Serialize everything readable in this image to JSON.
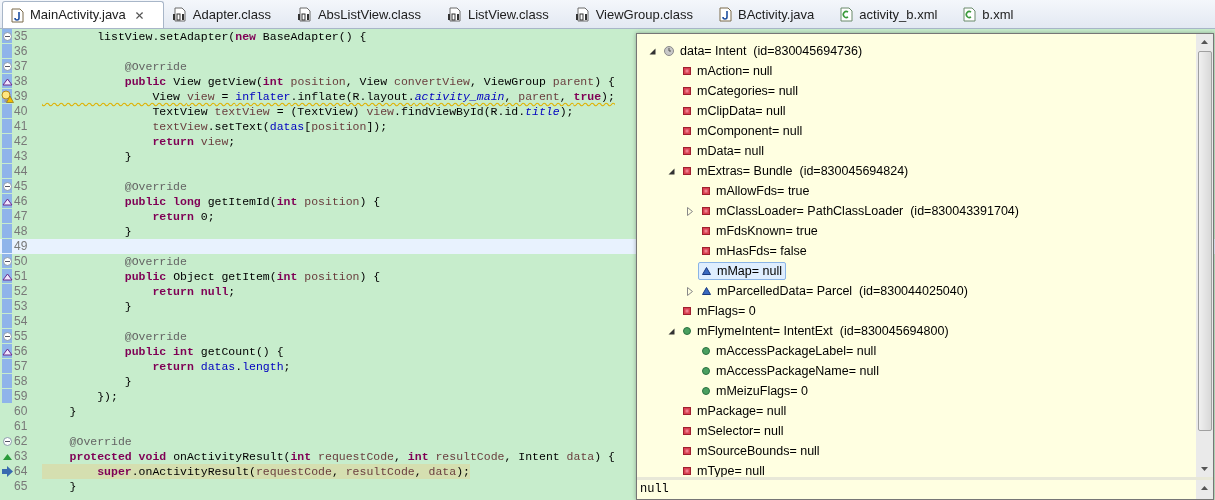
{
  "tabs": [
    {
      "label": "MainActivity.java",
      "kind": "java",
      "selected": true,
      "closable": true
    },
    {
      "label": "Adapter.class",
      "kind": "class",
      "selected": false,
      "closable": false
    },
    {
      "label": "AbsListView.class",
      "kind": "class",
      "selected": false,
      "closable": false
    },
    {
      "label": "ListView.class",
      "kind": "class",
      "selected": false,
      "closable": false
    },
    {
      "label": "ViewGroup.class",
      "kind": "class",
      "selected": false,
      "closable": false
    },
    {
      "label": "BActivity.java",
      "kind": "java",
      "selected": false,
      "closable": false
    },
    {
      "label": "activity_b.xml",
      "kind": "xml",
      "selected": false,
      "closable": false
    },
    {
      "label": "b.xml",
      "kind": "xml",
      "selected": false,
      "closable": false
    }
  ],
  "editor": {
    "lines": [
      {
        "number": "35",
        "fold": true,
        "override": false,
        "implements": false,
        "warning": false,
        "debug": false,
        "current": false,
        "changed": true,
        "code": [
          {
            "kind": "plain",
            "text": "        listView.setAdapter("
          },
          {
            "kind": "keyword",
            "text": "new"
          },
          {
            "kind": "plain",
            "text": " BaseAdapter() {"
          }
        ]
      },
      {
        "number": "36",
        "fold": false,
        "override": false,
        "implements": false,
        "warning": false,
        "debug": false,
        "current": false,
        "changed": true
      },
      {
        "number": "37",
        "fold": true,
        "override": false,
        "implements": false,
        "warning": false,
        "debug": false,
        "current": false,
        "changed": true,
        "code": [
          {
            "kind": "annotation",
            "text": "            @Override"
          }
        ]
      },
      {
        "number": "38",
        "fold": false,
        "override": true,
        "implements": false,
        "warning": false,
        "debug": false,
        "current": false,
        "changed": true,
        "code": [
          {
            "kind": "keyword",
            "text": "            public"
          },
          {
            "kind": "plain",
            "text": " View getView("
          },
          {
            "kind": "keyword",
            "text": "int"
          },
          {
            "kind": "variable",
            "text": " position"
          },
          {
            "kind": "plain",
            "text": ", View "
          },
          {
            "kind": "variable",
            "text": "convertView"
          },
          {
            "kind": "plain",
            "text": ", ViewGroup "
          },
          {
            "kind": "variable",
            "text": "parent"
          },
          {
            "kind": "plain",
            "text": ") {"
          }
        ]
      },
      {
        "number": "39",
        "fold": false,
        "override": false,
        "implements": false,
        "warning": true,
        "debug": false,
        "current": false,
        "changed": true,
        "code": [
          {
            "kind": "plain",
            "text": "                View "
          },
          {
            "kind": "variable",
            "text": "view"
          },
          {
            "kind": "plain",
            "text": " = "
          },
          {
            "kind": "field",
            "text": "inflater"
          },
          {
            "kind": "plain",
            "text": ".inflate(R.layout."
          },
          {
            "kind": "static",
            "text": "activity_main"
          },
          {
            "kind": "plain",
            "text": ", "
          },
          {
            "kind": "variable",
            "text": "parent"
          },
          {
            "kind": "plain",
            "text": ", "
          },
          {
            "kind": "keyword",
            "text": "true"
          },
          {
            "kind": "plain",
            "text": ");"
          }
        ]
      },
      {
        "number": "40",
        "fold": false,
        "override": false,
        "implements": false,
        "warning": false,
        "debug": false,
        "current": false,
        "changed": true,
        "code": [
          {
            "kind": "plain",
            "text": "                TextView "
          },
          {
            "kind": "variable",
            "text": "textView"
          },
          {
            "kind": "plain",
            "text": " = (TextView) "
          },
          {
            "kind": "variable",
            "text": "view"
          },
          {
            "kind": "plain",
            "text": ".findViewById(R.id."
          },
          {
            "kind": "static",
            "text": "title"
          },
          {
            "kind": "plain",
            "text": ");"
          }
        ]
      },
      {
        "number": "41",
        "fold": false,
        "override": false,
        "implements": false,
        "warning": false,
        "debug": false,
        "current": false,
        "changed": true,
        "code": [
          {
            "kind": "variable",
            "text": "                textView"
          },
          {
            "kind": "plain",
            "text": ".setText("
          },
          {
            "kind": "field",
            "text": "datas"
          },
          {
            "kind": "plain",
            "text": "["
          },
          {
            "kind": "variable",
            "text": "position"
          },
          {
            "kind": "plain",
            "text": "]);"
          }
        ]
      },
      {
        "number": "42",
        "fold": false,
        "override": false,
        "implements": false,
        "warning": false,
        "debug": false,
        "current": false,
        "changed": true,
        "code": [
          {
            "kind": "keyword",
            "text": "                return"
          },
          {
            "kind": "variable",
            "text": " view"
          },
          {
            "kind": "plain",
            "text": ";"
          }
        ]
      },
      {
        "number": "43",
        "fold": false,
        "override": false,
        "implements": false,
        "warning": false,
        "debug": false,
        "current": false,
        "changed": true,
        "code": [
          {
            "kind": "plain",
            "text": "            }"
          }
        ]
      },
      {
        "number": "44",
        "fold": false,
        "override": false,
        "implements": false,
        "warning": false,
        "debug": false,
        "current": false,
        "changed": true
      },
      {
        "number": "45",
        "fold": true,
        "override": false,
        "implements": false,
        "warning": false,
        "debug": false,
        "current": false,
        "changed": true,
        "code": [
          {
            "kind": "annotation",
            "text": "            @Override"
          }
        ]
      },
      {
        "number": "46",
        "fold": false,
        "override": true,
        "implements": false,
        "warning": false,
        "debug": false,
        "current": false,
        "changed": true,
        "code": [
          {
            "kind": "keyword",
            "text": "            public long"
          },
          {
            "kind": "plain",
            "text": " getItemId("
          },
          {
            "kind": "keyword",
            "text": "int"
          },
          {
            "kind": "variable",
            "text": " position"
          },
          {
            "kind": "plain",
            "text": ") {"
          }
        ]
      },
      {
        "number": "47",
        "fold": false,
        "override": false,
        "implements": false,
        "warning": false,
        "debug": false,
        "current": false,
        "changed": true,
        "code": [
          {
            "kind": "keyword",
            "text": "                return"
          },
          {
            "kind": "plain",
            "text": " 0;"
          }
        ]
      },
      {
        "number": "48",
        "fold": false,
        "override": false,
        "implements": false,
        "warning": false,
        "debug": false,
        "current": false,
        "changed": true,
        "code": [
          {
            "kind": "plain",
            "text": "            }"
          }
        ]
      },
      {
        "number": "49",
        "fold": false,
        "override": false,
        "implements": false,
        "warning": false,
        "debug": false,
        "current": true,
        "changed": true
      },
      {
        "number": "50",
        "fold": true,
        "override": false,
        "implements": false,
        "warning": false,
        "debug": false,
        "current": false,
        "changed": true,
        "code": [
          {
            "kind": "annotation",
            "text": "            @Override"
          }
        ]
      },
      {
        "number": "51",
        "fold": false,
        "override": true,
        "implements": false,
        "warning": false,
        "debug": false,
        "current": false,
        "changed": true,
        "code": [
          {
            "kind": "keyword",
            "text": "            public"
          },
          {
            "kind": "plain",
            "text": " Object getItem("
          },
          {
            "kind": "keyword",
            "text": "int"
          },
          {
            "kind": "variable",
            "text": " position"
          },
          {
            "kind": "plain",
            "text": ") {"
          }
        ]
      },
      {
        "number": "52",
        "fold": false,
        "override": false,
        "implements": false,
        "warning": false,
        "debug": false,
        "current": false,
        "changed": true,
        "code": [
          {
            "kind": "keyword",
            "text": "                return null"
          },
          {
            "kind": "plain",
            "text": ";"
          }
        ]
      },
      {
        "number": "53",
        "fold": false,
        "override": false,
        "implements": false,
        "warning": false,
        "debug": false,
        "current": false,
        "changed": true,
        "code": [
          {
            "kind": "plain",
            "text": "            }"
          }
        ]
      },
      {
        "number": "54",
        "fold": false,
        "override": false,
        "implements": false,
        "warning": false,
        "debug": false,
        "current": false,
        "changed": true
      },
      {
        "number": "55",
        "fold": true,
        "override": false,
        "implements": false,
        "warning": false,
        "debug": false,
        "current": false,
        "changed": true,
        "code": [
          {
            "kind": "annotation",
            "text": "            @Override"
          }
        ]
      },
      {
        "number": "56",
        "fold": false,
        "override": true,
        "implements": false,
        "warning": false,
        "debug": false,
        "current": false,
        "changed": true,
        "code": [
          {
            "kind": "keyword",
            "text": "            public int"
          },
          {
            "kind": "plain",
            "text": " getCount() {"
          }
        ]
      },
      {
        "number": "57",
        "fold": false,
        "override": false,
        "implements": false,
        "warning": false,
        "debug": false,
        "current": false,
        "changed": true,
        "code": [
          {
            "kind": "keyword",
            "text": "                return"
          },
          {
            "kind": "field",
            "text": " datas"
          },
          {
            "kind": "plain",
            "text": "."
          },
          {
            "kind": "field",
            "text": "length"
          },
          {
            "kind": "plain",
            "text": ";"
          }
        ]
      },
      {
        "number": "58",
        "fold": false,
        "override": false,
        "implements": false,
        "warning": false,
        "debug": false,
        "current": false,
        "changed": true,
        "code": [
          {
            "kind": "plain",
            "text": "            }"
          }
        ]
      },
      {
        "number": "59",
        "fold": false,
        "override": false,
        "implements": false,
        "warning": false,
        "debug": false,
        "current": false,
        "changed": true,
        "code": [
          {
            "kind": "plain",
            "text": "        });"
          }
        ]
      },
      {
        "number": "60",
        "fold": false,
        "override": false,
        "implements": false,
        "warning": false,
        "debug": false,
        "current": false,
        "changed": false,
        "code": [
          {
            "kind": "plain",
            "text": "    }"
          }
        ]
      },
      {
        "number": "61",
        "fold": false,
        "override": false,
        "implements": false,
        "warning": false,
        "debug": false,
        "current": false,
        "changed": false
      },
      {
        "number": "62",
        "fold": true,
        "override": false,
        "implements": false,
        "warning": false,
        "debug": false,
        "current": false,
        "changed": false,
        "code": [
          {
            "kind": "annotation",
            "text": "    @Override"
          }
        ]
      },
      {
        "number": "63",
        "fold": false,
        "override": false,
        "implements": true,
        "warning": false,
        "debug": false,
        "current": false,
        "changed": false,
        "code": [
          {
            "kind": "keyword",
            "text": "    protected void"
          },
          {
            "kind": "plain",
            "text": " onActivityResult("
          },
          {
            "kind": "keyword",
            "text": "int"
          },
          {
            "kind": "variable",
            "text": " requestCode"
          },
          {
            "kind": "plain",
            "text": ", "
          },
          {
            "kind": "keyword",
            "text": "int"
          },
          {
            "kind": "variable",
            "text": " resultCode"
          },
          {
            "kind": "plain",
            "text": ", Intent "
          },
          {
            "kind": "variable",
            "text": "data"
          },
          {
            "kind": "plain",
            "text": ") {"
          }
        ]
      },
      {
        "number": "64",
        "fold": false,
        "override": false,
        "implements": false,
        "warning": false,
        "debug": true,
        "current": false,
        "changed": false,
        "code": [
          {
            "kind": "keyword",
            "text": "        super"
          },
          {
            "kind": "plain",
            "text": ".onActivityResult("
          },
          {
            "kind": "variable",
            "text": "requestCode"
          },
          {
            "kind": "plain",
            "text": ", "
          },
          {
            "kind": "variable",
            "text": "resultCode"
          },
          {
            "kind": "plain",
            "text": ", "
          },
          {
            "kind": "variable",
            "text": "data"
          },
          {
            "kind": "plain",
            "text": ");"
          }
        ]
      },
      {
        "number": "65",
        "fold": false,
        "override": false,
        "implements": false,
        "warning": false,
        "debug": false,
        "current": false,
        "changed": false,
        "code": [
          {
            "kind": "plain",
            "text": "    }"
          }
        ]
      }
    ]
  },
  "inspector": {
    "tree": [
      {
        "label": "data= Intent  (id=830045694736)",
        "kind": "local",
        "expanded": true,
        "selected": false,
        "children": [
          {
            "label": "mAction= null",
            "kind": "private",
            "selected": false
          },
          {
            "label": "mCategories= null",
            "kind": "private",
            "selected": false
          },
          {
            "label": "mClipData= null",
            "kind": "private",
            "selected": false
          },
          {
            "label": "mComponent= null",
            "kind": "private",
            "selected": false
          },
          {
            "label": "mData= null",
            "kind": "private",
            "selected": false
          },
          {
            "label": "mExtras= Bundle  (id=830045694824)",
            "kind": "private",
            "expanded": true,
            "selected": false,
            "children": [
              {
                "label": "mAllowFds= true",
                "kind": "private",
                "selected": false
              },
              {
                "label": "mClassLoader= PathClassLoader  (id=830043391704)",
                "kind": "private",
                "expanded": false,
                "selected": false
              },
              {
                "label": "mFdsKnown= true",
                "kind": "private",
                "selected": false
              },
              {
                "label": "mHasFds= false",
                "kind": "private",
                "selected": false
              },
              {
                "label": "mMap= null",
                "kind": "package",
                "selected": true
              },
              {
                "label": "mParcelledData= Parcel  (id=830044025040)",
                "kind": "package",
                "expanded": false,
                "selected": false
              }
            ]
          },
          {
            "label": "mFlags= 0",
            "kind": "private",
            "selected": false
          },
          {
            "label": "mFlymeIntent= IntentExt  (id=830045694800)",
            "kind": "public",
            "expanded": true,
            "selected": false,
            "children": [
              {
                "label": "mAccessPackageLabel= null",
                "kind": "public",
                "selected": false
              },
              {
                "label": "mAccessPackageName= null",
                "kind": "public",
                "selected": false
              },
              {
                "label": "mMeizuFlags= 0",
                "kind": "public",
                "selected": false
              }
            ]
          },
          {
            "label": "mPackage= null",
            "kind": "private",
            "selected": false
          },
          {
            "label": "mSelector= null",
            "kind": "private",
            "selected": false
          },
          {
            "label": "mSourceBounds= null",
            "kind": "private",
            "selected": false
          },
          {
            "label": "mType= null",
            "kind": "private",
            "selected": false
          }
        ]
      }
    ],
    "detail": "null"
  }
}
